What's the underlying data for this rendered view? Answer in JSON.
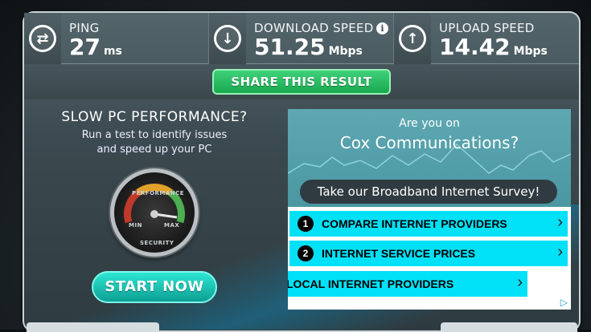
{
  "stats": {
    "ping": {
      "label": "PING",
      "value": "27",
      "unit": "ms",
      "icon": "swap-arrows-icon"
    },
    "download": {
      "label": "DOWNLOAD SPEED",
      "value": "51.25",
      "unit": "Mbps",
      "icon": "arrow-down-icon",
      "info": "i"
    },
    "upload": {
      "label": "UPLOAD SPEED",
      "value": "14.42",
      "unit": "Mbps",
      "icon": "arrow-up-icon"
    }
  },
  "share": {
    "label": "SHARE THIS RESULT"
  },
  "promo": {
    "title": "SLOW PC PERFORMANCE?",
    "line1": "Run a test to identify issues",
    "line2": "and speed up your PC",
    "gauge": {
      "top": "PERFORMANCE",
      "min": "MIN",
      "max": "MAX",
      "bottom": "SECURITY"
    },
    "button": "START NOW"
  },
  "ad": {
    "question1": "Are you on",
    "question2": "Cox Communications?",
    "survey": "Take our Broadband Internet Survey!",
    "links": [
      {
        "num": "1",
        "label": "COMPARE INTERNET PROVIDERS"
      },
      {
        "num": "2",
        "label": "INTERNET SERVICE PRICES"
      },
      {
        "label": "LOCAL INTERNET PROVIDERS"
      }
    ]
  },
  "colors": {
    "accent": "#00e0f7",
    "share": "#19a84f",
    "start": "#0c9f93"
  }
}
